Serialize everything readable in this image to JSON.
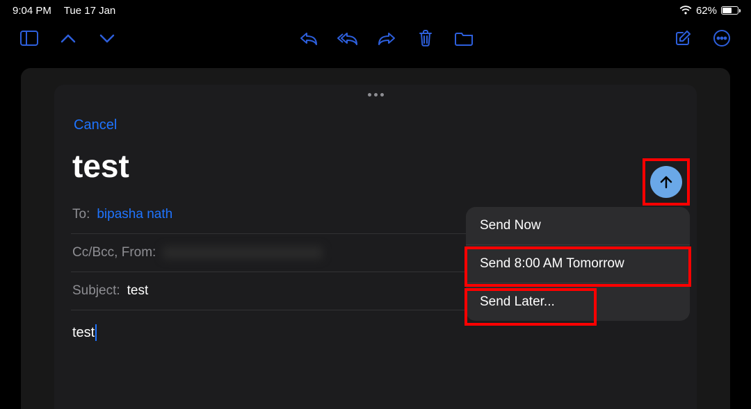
{
  "status": {
    "time": "9:04 PM",
    "date": "Tue 17 Jan",
    "battery_pct": "62%",
    "battery_fill": 62
  },
  "compose": {
    "cancel": "Cancel",
    "title": "test",
    "to_label": "To:",
    "to_value": "bipasha nath",
    "ccbcc_label": "Cc/Bcc, From:",
    "subject_label": "Subject:",
    "subject_value": "test",
    "body": "test"
  },
  "send_menu": {
    "now": "Send Now",
    "tomorrow": "Send 8:00 AM Tomorrow",
    "later": "Send Later..."
  }
}
